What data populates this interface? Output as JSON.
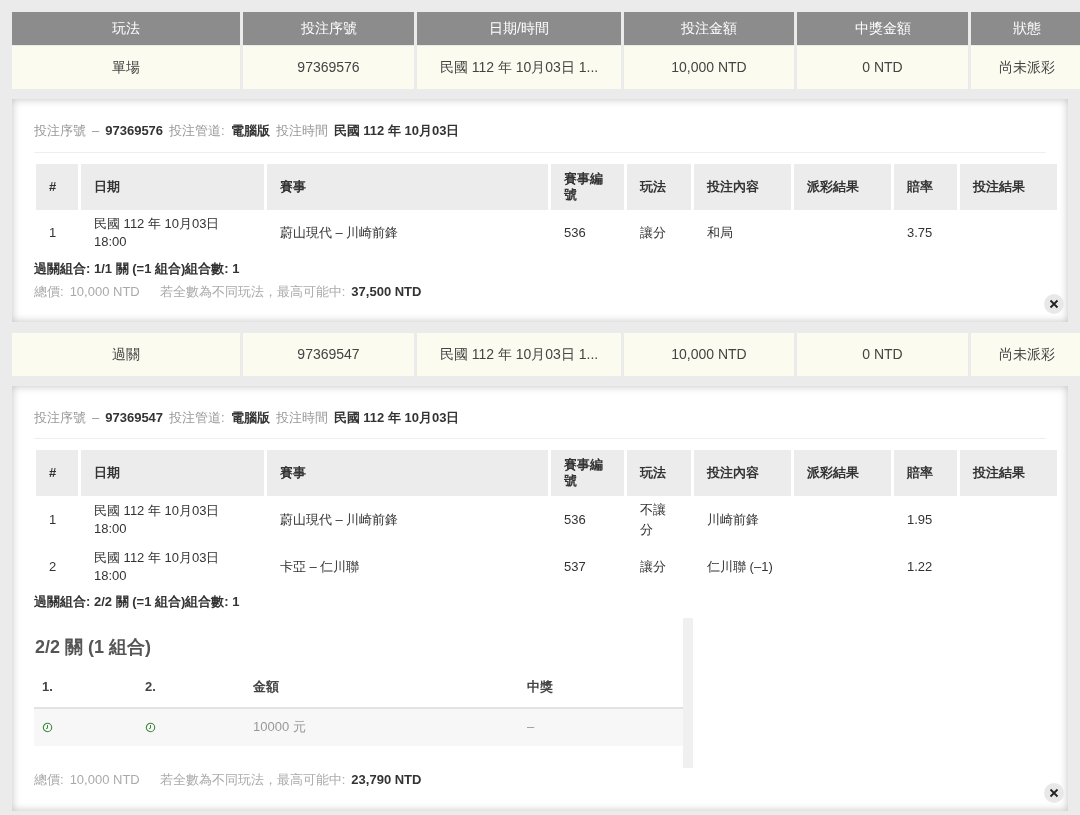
{
  "summary_columns": [
    "玩法",
    "投注序號",
    "日期/時間",
    "投注金額",
    "中獎金額",
    "狀態"
  ],
  "bets": [
    {
      "summary": [
        "單場",
        "97369576",
        "民國 112 年 10月03日 1...",
        "10,000 NTD",
        "0 NTD",
        "尚未派彩"
      ],
      "meta": {
        "serial_label": "投注序號",
        "dash": "–",
        "serial": "97369576",
        "channel_label": "投注管道:",
        "channel": "電腦版",
        "time_label": "投注時間",
        "time": "民國 112 年 10月03日"
      },
      "columns": [
        "#",
        "日期",
        "賽事",
        "賽事編號",
        "玩法",
        "投注內容",
        "派彩結果",
        "賠率",
        "投注結果"
      ],
      "rows": [
        {
          "no": "1",
          "date": "民國 112 年 10月03日",
          "time": "18:00",
          "match": "蔚山現代 – 川崎前鋒",
          "match_no": "536",
          "play": "讓分",
          "pick": "和局",
          "odds": "3.75"
        }
      ],
      "combo": "過關組合: 1/1 關 (=1 組合)組合數: 1",
      "total_label": "總價:",
      "total": "10,000 NTD",
      "max_label": "若全數為不同玩法，最高可能中:",
      "max": "37,500 NTD"
    },
    {
      "summary": [
        "過關",
        "97369547",
        "民國 112 年 10月03日 1...",
        "10,000 NTD",
        "0 NTD",
        "尚未派彩"
      ],
      "meta": {
        "serial_label": "投注序號",
        "dash": "–",
        "serial": "97369547",
        "channel_label": "投注管道:",
        "channel": "電腦版",
        "time_label": "投注時間",
        "time": "民國 112 年 10月03日"
      },
      "columns": [
        "#",
        "日期",
        "賽事",
        "賽事編號",
        "玩法",
        "投注內容",
        "派彩結果",
        "賠率",
        "投注結果"
      ],
      "rows": [
        {
          "no": "1",
          "date": "民國 112 年 10月03日",
          "time": "18:00",
          "match": "蔚山現代 – 川崎前鋒",
          "match_no": "536",
          "play": "不讓分",
          "pick": "川崎前鋒",
          "odds": "1.95"
        },
        {
          "no": "2",
          "date": "民國 112 年 10月03日",
          "time": "18:00",
          "match": "卡亞 – 仁川聯",
          "match_no": "537",
          "play": "讓分",
          "pick": "仁川聯 (–1)",
          "odds": "1.22"
        }
      ],
      "combo": "過關組合: 2/2 關 (=1 組合)組合數: 1",
      "parlay": {
        "title": "2/2 關 (1 組合)",
        "columns": [
          {
            "label": "1.",
            "kind": "leg"
          },
          {
            "label": "2.",
            "kind": "leg"
          },
          {
            "label": "金額",
            "kind": "amount"
          },
          {
            "label": "中獎",
            "kind": "prize"
          }
        ],
        "amount": "10000 元",
        "prize": "–"
      },
      "total_label": "總價:",
      "total": "10,000 NTD",
      "max_label": "若全數為不同玩法，最高可能中:",
      "max": "23,790 NTD"
    }
  ]
}
